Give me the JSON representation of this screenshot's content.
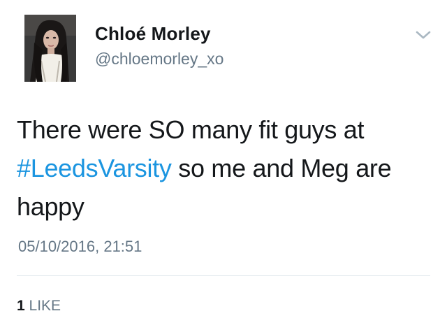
{
  "tweet": {
    "author": {
      "display_name": "Chloé Morley",
      "handle": "@chloemorley_xo",
      "avatar_icon": "profile-photo"
    },
    "menu_icon": "chevron-down-icon",
    "text": {
      "line1": "There were SO many fit guys at",
      "hashtag": "#LeedsVarsity",
      "after_hashtag": " so me and Meg are",
      "line3": "happy"
    },
    "timestamp": "05/10/2016, 21:51",
    "likes": {
      "count": "1",
      "label": "LIKE"
    },
    "colors": {
      "hashtag": "#1b95e0",
      "secondary_text": "#657786",
      "primary_text": "#14171a",
      "divider": "#e1e8ed"
    }
  }
}
